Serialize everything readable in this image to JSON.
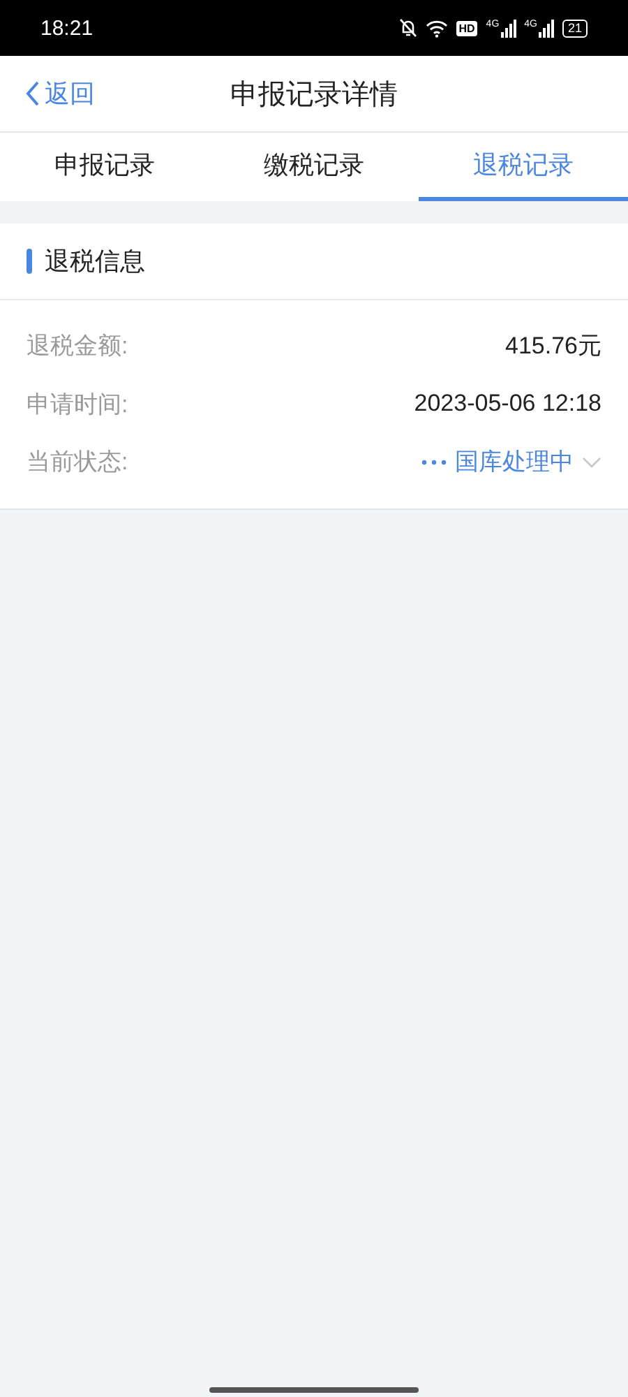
{
  "status_bar": {
    "time": "18:21",
    "hd_badge": "HD",
    "networks": [
      {
        "label": "4G"
      },
      {
        "label": "4G"
      }
    ],
    "battery": "21"
  },
  "nav": {
    "back": "返回",
    "title": "申报记录详情"
  },
  "tabs": [
    {
      "label": "申报记录",
      "selected": false
    },
    {
      "label": "缴税记录",
      "selected": false
    },
    {
      "label": "退税记录",
      "selected": true
    }
  ],
  "section": {
    "title": "退税信息"
  },
  "rows": [
    {
      "kind": "plain",
      "label": "退税金额:",
      "value": "415.76元"
    },
    {
      "kind": "plain",
      "label": "申请时间:",
      "value": "2023-05-06 12:18"
    },
    {
      "kind": "status",
      "label": "当前状态:",
      "value": "国库处理中"
    }
  ]
}
